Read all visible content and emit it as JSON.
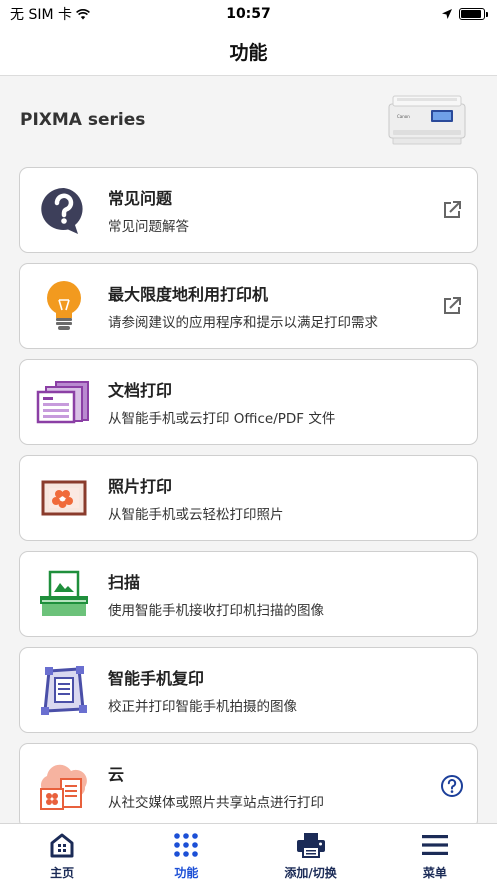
{
  "status_bar": {
    "carrier": "无 SIM 卡",
    "time": "10:57",
    "battery_level": 0.9
  },
  "nav": {
    "title": "功能"
  },
  "printer": {
    "name": "PIXMA series",
    "brand_mark": "Canon"
  },
  "cards": [
    {
      "title": "常见问题",
      "subtitle": "常见问题解答",
      "icon": "question-bubble-icon",
      "action": "external-link-icon"
    },
    {
      "title": "最大限度地利用打印机",
      "subtitle": "请参阅建议的应用程序和提示以满足打印需求",
      "icon": "lightbulb-icon",
      "action": "external-link-icon"
    },
    {
      "title": "文档打印",
      "subtitle": "从智能手机或云打印 Office/PDF 文件",
      "icon": "documents-icon"
    },
    {
      "title": "照片打印",
      "subtitle": "从智能手机或云轻松打印照片",
      "icon": "photo-icon"
    },
    {
      "title": "扫描",
      "subtitle": "使用智能手机接收打印机扫描的图像",
      "icon": "scanner-icon"
    },
    {
      "title": "智能手机复印",
      "subtitle": "校正并打印智能手机拍摄的图像",
      "icon": "phone-copy-icon"
    },
    {
      "title": "云",
      "subtitle": "从社交媒体或照片共享站点进行打印",
      "icon": "cloud-icon",
      "action": "help-circle-icon"
    }
  ],
  "tabs": [
    {
      "label": "主页",
      "icon": "home-icon",
      "active": false
    },
    {
      "label": "功能",
      "icon": "grid-dots-icon",
      "active": true
    },
    {
      "label": "添加/切换",
      "icon": "printer-icon",
      "active": false
    },
    {
      "label": "菜单",
      "icon": "hamburger-menu-icon",
      "active": false
    }
  ],
  "colors": {
    "accent": "#1c4fd6",
    "navy": "#1b2b57",
    "question_icon": "#3d3f5a",
    "bulb": "#f29a1f",
    "documents": "#8b3fa5",
    "photo": "#8a3b2c",
    "scan": "#1f8f3c",
    "copy": "#4a4fa8",
    "cloud": "#e8603c"
  }
}
